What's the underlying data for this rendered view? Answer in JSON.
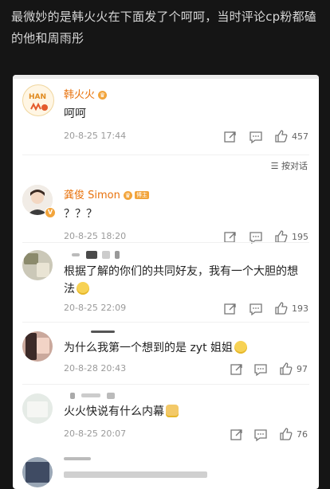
{
  "caption": "最微妙的是韩火火在下面发了个呵呵，当时评论cp粉都磕的他和周雨彤",
  "sort_label": "按对话",
  "comments": [
    {
      "name": "韩火火",
      "text": "呵呵",
      "time": "20-8-25 17:44",
      "likes": "457",
      "badge_icon": "crown-icon"
    },
    {
      "name": "龚俊 Simon",
      "text": "？？？",
      "time": "20-8-25 18:20",
      "likes": "195",
      "badge_icon": "crown-icon",
      "tag": "博主"
    },
    {
      "name": "",
      "text": "根据了解的你们的共同好友，我有一个大胆的想法",
      "time": "20-8-25 22:09",
      "likes": "193",
      "emoji": "smile-emoji"
    },
    {
      "name": "",
      "text": "为什么我第一个想到的是 zyt 姐姐",
      "time": "20-8-28 20:43",
      "likes": "97",
      "emoji": "smile-emoji"
    },
    {
      "name": "",
      "text": "火火快说有什么内幕",
      "time": "20-8-25 20:07",
      "likes": "76",
      "emoji": "doge-emoji"
    }
  ],
  "colors": {
    "name": "#e8720c",
    "badge": "#f2a43b",
    "time": "#9a9a9a"
  }
}
